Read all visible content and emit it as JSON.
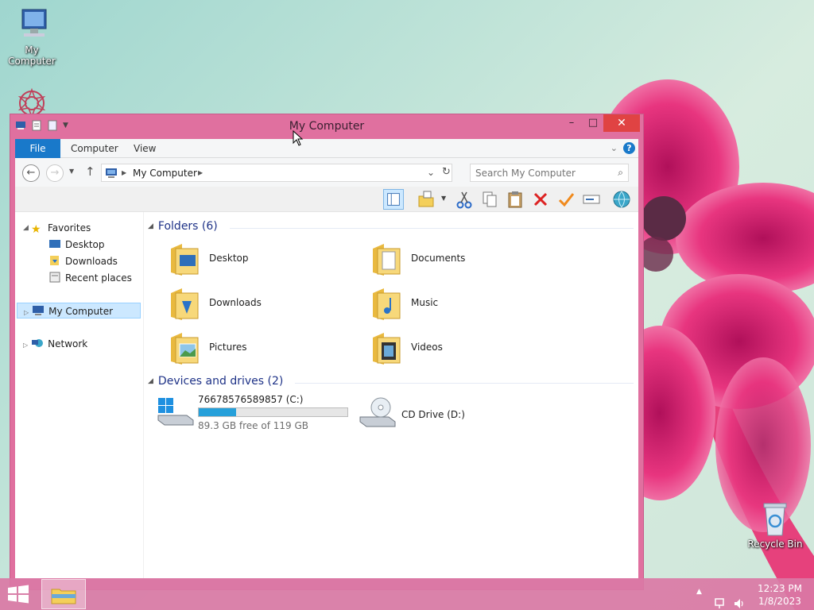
{
  "desktop": {
    "icons": [
      {
        "label": "My Computer"
      },
      {
        "label": "Recycle Bin"
      }
    ]
  },
  "window": {
    "title": "My Computer",
    "controls": {
      "minimize": "–",
      "maximize": "□",
      "close": "✕"
    },
    "ribbon_tabs": [
      "File",
      "Computer",
      "View"
    ],
    "address": {
      "location": "My Computer"
    },
    "search": {
      "placeholder": "Search My Computer"
    }
  },
  "navigation": {
    "favorites": {
      "label": "Favorites",
      "items": [
        "Desktop",
        "Downloads",
        "Recent places"
      ]
    },
    "my_computer": "My Computer",
    "network": "Network"
  },
  "folders_group": {
    "header": "Folders (6)",
    "items": [
      "Desktop",
      "Documents",
      "Downloads",
      "Music",
      "Pictures",
      "Videos"
    ]
  },
  "drives_group": {
    "header": "Devices and drives (2)",
    "drives": [
      {
        "name": "76678576589857 (C:)",
        "free_text": "89.3 GB free of 119 GB",
        "used_fraction": 0.25
      },
      {
        "name": "CD Drive (D:)"
      }
    ]
  },
  "taskbar": {
    "time": "12:23 PM",
    "date": "1/8/2023"
  },
  "colors": {
    "accent": "#1979ca",
    "window_frame": "#e0709f",
    "close_button": "#e04343",
    "drive_fill": "#26a0da",
    "group_header": "#1e3287"
  }
}
